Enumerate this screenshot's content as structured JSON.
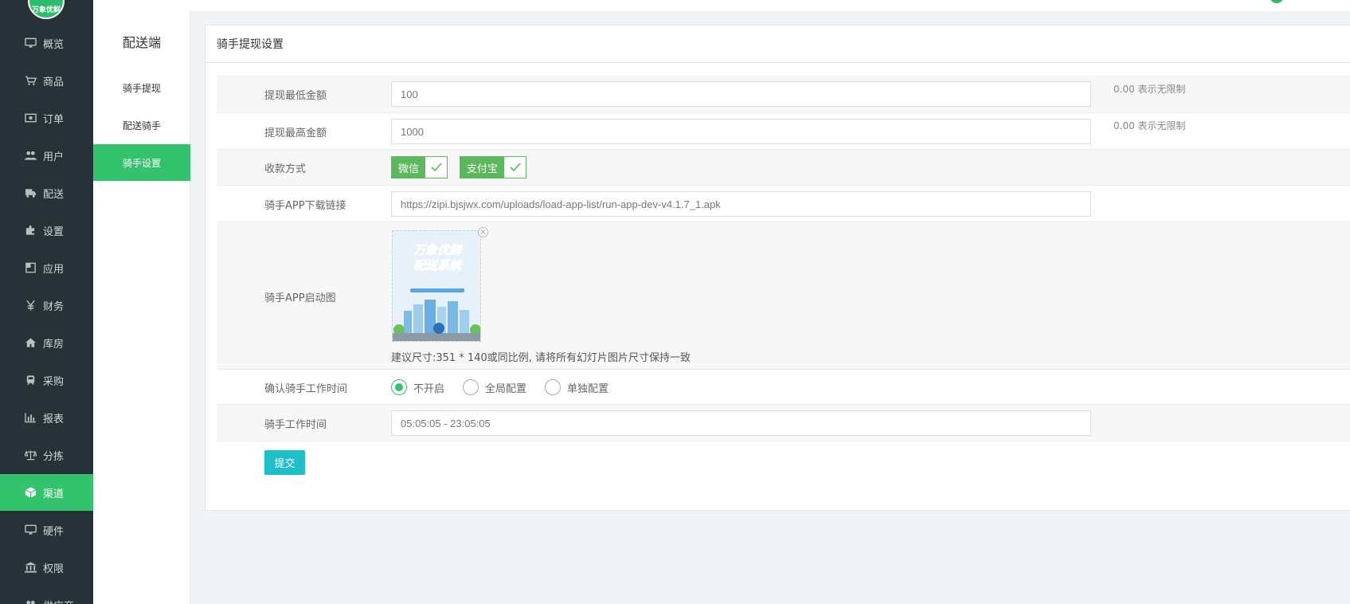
{
  "brand": {
    "logo_text": "万象优鲜"
  },
  "sidebar": {
    "items": [
      {
        "label": "概览",
        "icon": "monitor-icon"
      },
      {
        "label": "商品",
        "icon": "cart-icon"
      },
      {
        "label": "订单",
        "icon": "money-icon"
      },
      {
        "label": "用户",
        "icon": "users-icon"
      },
      {
        "label": "配送",
        "icon": "truck-icon"
      },
      {
        "label": "设置",
        "icon": "puzzle-icon"
      },
      {
        "label": "应用",
        "icon": "apps-icon"
      },
      {
        "label": "财务",
        "icon": "yen-icon"
      },
      {
        "label": "库房",
        "icon": "home-icon"
      },
      {
        "label": "采购",
        "icon": "train-icon"
      },
      {
        "label": "报表",
        "icon": "bar-chart-icon"
      },
      {
        "label": "分拣",
        "icon": "scale-icon"
      },
      {
        "label": "渠道",
        "icon": "cube-icon",
        "active": true
      },
      {
        "label": "硬件",
        "icon": "monitor-icon"
      },
      {
        "label": "权限",
        "icon": "bank-icon"
      },
      {
        "label": "供应商",
        "icon": "users-icon"
      }
    ]
  },
  "subbar": {
    "title": "配送端",
    "items": [
      {
        "label": "骑手提现"
      },
      {
        "label": "配送骑手"
      },
      {
        "label": "骑手设置",
        "active": true
      }
    ]
  },
  "panel": {
    "title": "骑手提现设置",
    "min_amount": {
      "label": "提现最低金额",
      "value": "100",
      "hint": "0.00 表示无限制"
    },
    "max_amount": {
      "label": "提现最高金额",
      "value": "1000",
      "hint": "0.00 表示无限制"
    },
    "payment": {
      "label": "收款方式",
      "options": [
        "微信",
        "支付宝"
      ]
    },
    "app_link": {
      "label": "骑手APP下载链接",
      "value": "https://zipi.bjsjwx.com/uploads/load-app-list/run-app-dev-v4.1.7_1.apk"
    },
    "splash": {
      "label": "骑手APP启动图",
      "image_line1": "万象优鲜",
      "image_line2": "配送系统",
      "note": "建议尺寸:351 * 140或同比例, 请将所有幻灯片图片尺寸保持一致"
    },
    "work_confirm": {
      "label": "确认骑手工作时间",
      "options": [
        "不开启",
        "全局配置",
        "单独配置"
      ],
      "selected": "不开启"
    },
    "work_time": {
      "label": "骑手工作时间",
      "value": "05:05:05 - 23:05:05"
    },
    "submit_label": "提交"
  },
  "colors": {
    "sidebar_bg": "#263238",
    "accent_green": "#33c36d",
    "submit_teal": "#1fbfc8",
    "check_green": "#5cb85c"
  }
}
